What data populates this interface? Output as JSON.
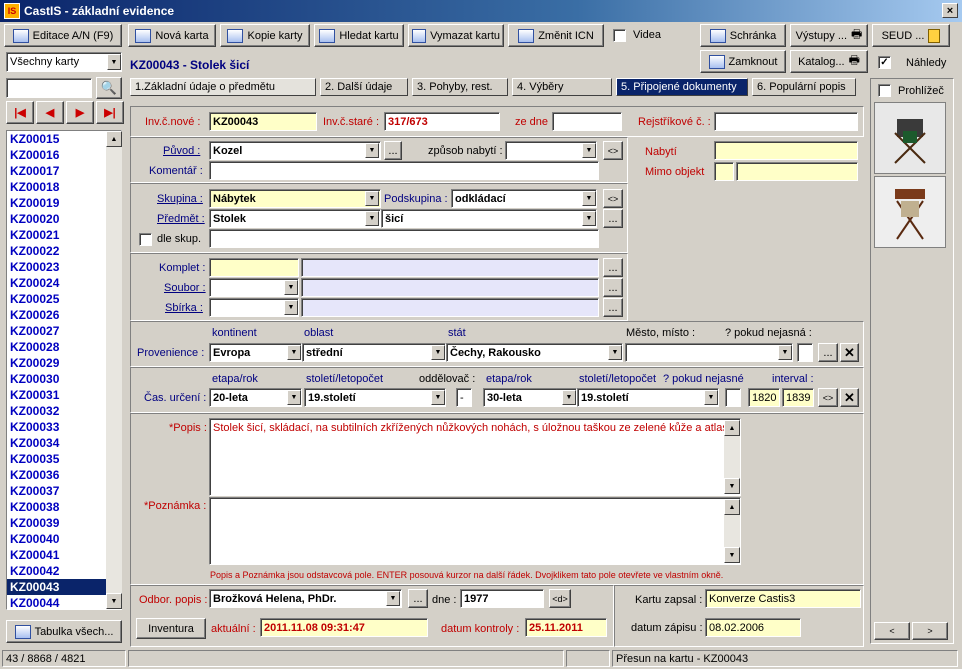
{
  "window": {
    "title": "CastIS - základní evidence",
    "logo": "IS",
    "close": "×"
  },
  "toolbar": {
    "edit": "Editace A/N (F9)",
    "new": "Nová karta",
    "copy": "Kopie karty",
    "find": "Hledat kartu",
    "delete": "Vymazat kartu",
    "change_icn": "Změnit ICN",
    "videa": "Videa",
    "clipboard": "Schránka",
    "outputs": "Výstupy ...",
    "seud": "SEUD ...",
    "lock": "Zamknout",
    "catalog": "Katalog...",
    "previews": "Náhledy",
    "browser": "Prohlížeč"
  },
  "filter": {
    "value": "Všechny karty"
  },
  "card": {
    "header": "KZ00043 - Stolek šicí"
  },
  "tabs": [
    {
      "label": "1.Základní údaje o předmětu"
    },
    {
      "label": "2. Další údaje"
    },
    {
      "label": "3. Pohyby, rest."
    },
    {
      "label": "4. Výběry"
    },
    {
      "label": "5. Připojené dokumenty"
    },
    {
      "label": "6. Populární popis"
    }
  ],
  "list": {
    "items": [
      "KZ00015",
      "KZ00016",
      "KZ00017",
      "KZ00018",
      "KZ00019",
      "KZ00020",
      "KZ00021",
      "KZ00022",
      "KZ00023",
      "KZ00024",
      "KZ00025",
      "KZ00026",
      "KZ00027",
      "KZ00028",
      "KZ00029",
      "KZ00030",
      "KZ00031",
      "KZ00032",
      "KZ00033",
      "KZ00034",
      "KZ00035",
      "KZ00036",
      "KZ00037",
      "KZ00038",
      "KZ00039",
      "KZ00040",
      "KZ00041",
      "KZ00042",
      "KZ00043",
      "KZ00044"
    ],
    "selected": "KZ00043",
    "table_btn": "Tabulka všech..."
  },
  "form": {
    "inv_new_lbl": "Inv.č.nové :",
    "inv_new": "KZ00043",
    "inv_old_lbl": "Inv.č.staré :",
    "inv_old": "317/673",
    "ze_dne_lbl": "ze dne",
    "rejstrik_lbl": "Rejstříkové č. :",
    "puvod_lbl": "Původ :",
    "puvod": "Kozel",
    "zpusob_lbl": "způsob nabytí :",
    "komentar_lbl": "Komentář :",
    "nabyti_lbl": "Nabytí",
    "mimo_lbl": "Mimo objekt",
    "skupina_lbl": "Skupina :",
    "skupina": "Nábytek",
    "podskupina_lbl": "Podskupina :",
    "podskupina": "odkládací",
    "predmet_lbl": "Předmět :",
    "predmet": "Stolek",
    "predmet2": "šicí",
    "dle_skup": "dle skup.",
    "komplet_lbl": "Komplet :",
    "soubor_lbl": "Soubor :",
    "sbirka_lbl": "Sbírka :",
    "kontinent_lbl": "kontinent",
    "oblast_lbl": "oblast",
    "stat_lbl": "stát",
    "mesto_lbl": "Město, místo :",
    "nejasna_lbl": "? pokud nejasná :",
    "provenience_lbl": "Provenience :",
    "kontinent": "Evropa",
    "oblast": "střední",
    "stat": "Čechy, Rakousko",
    "etapa_lbl": "etapa/rok",
    "stoleti_lbl": "století/letopočet",
    "oddelovac_lbl": "oddělovač :",
    "etapa2_lbl": "etapa/rok",
    "stoleti2_lbl": "století/letopočet",
    "nejasne_lbl": "? pokud nejasné",
    "interval_lbl": "interval :",
    "cas_lbl": "Čas. určení :",
    "etapa": "20-leta",
    "stoleti": "19.století",
    "oddelovac": "-",
    "etapa2": "30-leta",
    "stoleti2": "19.století",
    "int_from": "1820",
    "int_to": "1839",
    "popis_lbl": "*Popis :",
    "popis": "Stolek šicí, skládací, na subtilních zkřížených nůžkových nohách, s úložnou taškou ze zelené kůže a atlasu.",
    "poznamka_lbl": "*Poznámka :",
    "hint": "Popis a Poznámka jsou odstavcová pole. ENTER posouvá kurzor na další řádek. Dvojklikem tato pole otevřete ve vlastním okně.",
    "odbor_lbl": "Odbor. popis :",
    "odbor": "Brožková Helena, PhDr.",
    "dne_lbl": "dne :",
    "dne": "1977",
    "zapsal_lbl": "Kartu zapsal :",
    "zapsal": "Konverze Castis3",
    "inventura": "Inventura",
    "aktualni_lbl": "aktuální :",
    "aktualni": "2011.11.08 09:31:47",
    "kontrola_lbl": "datum kontroly :",
    "kontrola": "25.11.2011",
    "zapisu_lbl": "datum zápisu :",
    "zapisu": "08.02.2006"
  },
  "status": {
    "count": "43 / 8868 / 4821",
    "message": "Přesun na kartu - KZ00043"
  },
  "colors": {
    "title_bg": "#0a246a",
    "yellow": "#ffffc8",
    "lavender": "#e6e6fa",
    "red": "#c00000"
  }
}
